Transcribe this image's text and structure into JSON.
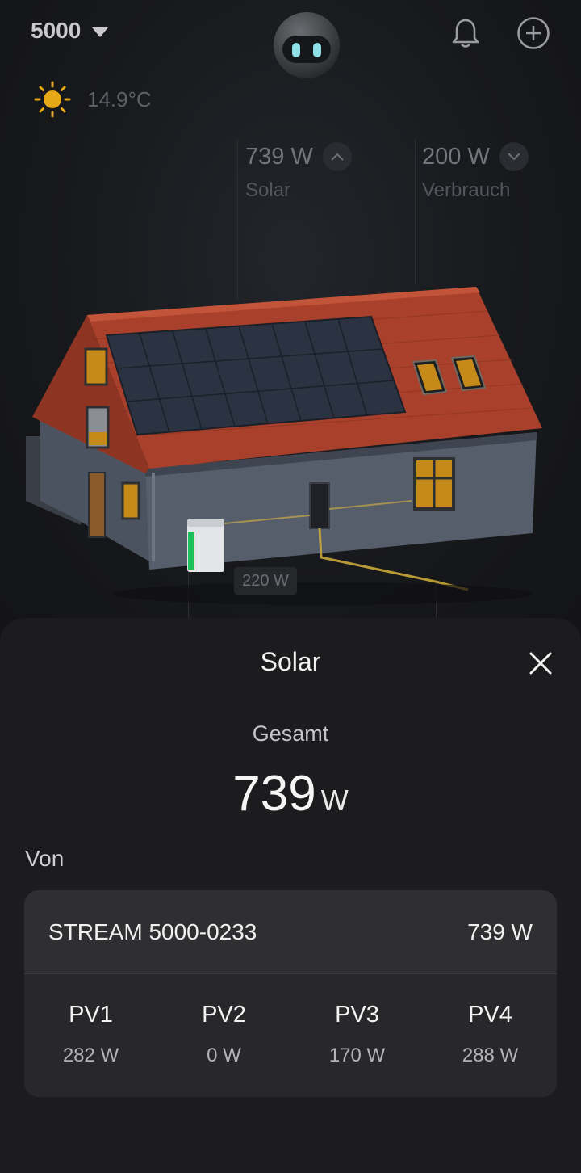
{
  "header": {
    "device": "5000",
    "temperature": "14.9°C"
  },
  "stats": {
    "solar": {
      "value": "739 W",
      "label": "Solar"
    },
    "consumption": {
      "value": "200 W",
      "label": "Verbrauch"
    },
    "grid_badge": "220 W"
  },
  "sheet": {
    "title": "Solar",
    "total_label": "Gesamt",
    "total_value": "739",
    "total_unit": "W",
    "from_label": "Von",
    "device_name": "STREAM 5000-0233",
    "device_power": "739 W",
    "pv": [
      {
        "name": "PV1",
        "value": "282 W"
      },
      {
        "name": "PV2",
        "value": "0 W"
      },
      {
        "name": "PV3",
        "value": "170 W"
      },
      {
        "name": "PV4",
        "value": "288 W"
      }
    ]
  },
  "icons": {
    "dropdown": "caret-down-icon",
    "assistant": "robot-avatar",
    "notifications": "bell-icon",
    "add": "plus-circle-icon",
    "weather": "sun-icon",
    "trend_up": "chevron-up-icon",
    "trend_down": "chevron-down-icon",
    "close": "close-icon"
  },
  "colors": {
    "background": "#16171a",
    "sheet": "#1c1c1e",
    "sun": "#e6a817",
    "roof": "#a8402c",
    "battery_accent": "#20c05a"
  }
}
